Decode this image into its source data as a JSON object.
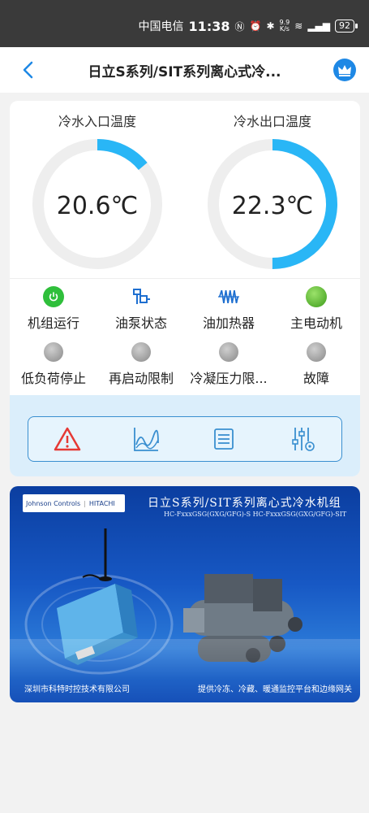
{
  "status_bar": {
    "carrier": "中国电信",
    "time": "11:38",
    "net_speed_value": "9.9",
    "net_speed_unit": "K/s",
    "battery": "92"
  },
  "header": {
    "title": "日立S系列/SIT系列离心式冷..."
  },
  "gauges": [
    {
      "label": "冷水入口温度",
      "value": "20.6℃",
      "fill_fraction": 0.14
    },
    {
      "label": "冷水出口温度",
      "value": "22.3℃",
      "fill_fraction": 0.5
    }
  ],
  "status_items": [
    {
      "label": "机组运行",
      "icon": "power-icon",
      "state": "on"
    },
    {
      "label": "油泵状态",
      "icon": "pump-icon",
      "state": "neutral"
    },
    {
      "label": "油加热器",
      "icon": "heater-icon",
      "state": "neutral"
    },
    {
      "label": "主电动机",
      "icon": "green-dot-icon",
      "state": "on"
    },
    {
      "label": "低负荷停止",
      "icon": "gray-dot-icon",
      "state": "off"
    },
    {
      "label": "再启动限制",
      "icon": "gray-dot-icon",
      "state": "off"
    },
    {
      "label": "冷凝压力限...",
      "icon": "gray-dot-icon",
      "state": "off"
    },
    {
      "label": "故障",
      "icon": "gray-dot-icon",
      "state": "off"
    }
  ],
  "tools": [
    "alarm-icon",
    "trend-chart-icon",
    "list-icon",
    "settings-sliders-icon"
  ],
  "banner": {
    "logo_left": "Johnson Controls",
    "logo_right": "HITACHI",
    "title": "日立S系列/SIT系列离心式冷水机组",
    "subtitle": "HC-FxxxGSG(GXG/GFG)-S HC-FxxxGSG(GXG/GFG)-SIT",
    "footer_left": "深圳市科特时控技术有限公司",
    "footer_right": "提供冷冻、冷藏、暖通监控平台和边缘网关"
  },
  "colors": {
    "accent": "#1e88e5",
    "gauge_track": "#eeeeee",
    "gauge_fill": "#29b6f6",
    "run_green": "#2fbf3b",
    "icon_blue": "#1e6fd0",
    "alarm_red": "#e53935"
  }
}
